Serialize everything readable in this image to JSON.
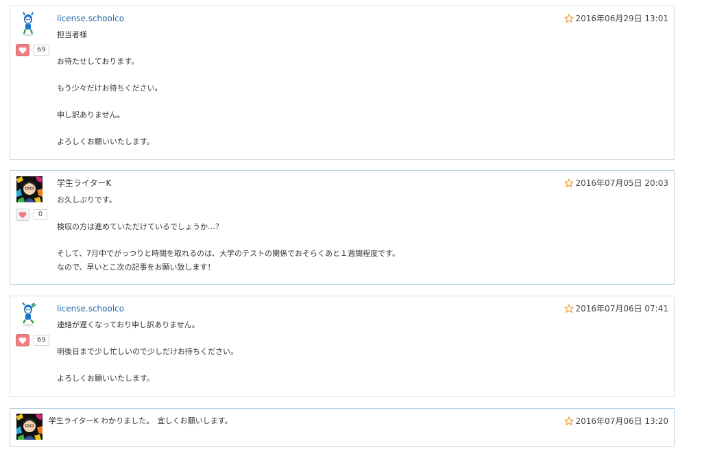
{
  "comments": [
    {
      "author": "license.schoolco",
      "date": "2016年06月29日 13:01",
      "likes": "69",
      "lines": [
        "担当者様",
        "",
        "お待たせしております。",
        "",
        "もう少々だけお待ちください。",
        "",
        "申し訳ありません。",
        "",
        "よろしくお願いいたします。"
      ]
    },
    {
      "author": "学生ライターK",
      "date": "2016年07月05日 20:03",
      "likes": "0",
      "lines": [
        "お久しぶりです。",
        "",
        "検収の方は進めていただけているでしょうか…？",
        "",
        "そして、7月中でがっつりと時間を取れるのは、大学のテストの関係でおそらくあと１週間程度です。",
        "なので、早いとこ次の記事をお願い致します！"
      ]
    },
    {
      "author": "license.schoolco",
      "date": "2016年07月06日 07:41",
      "likes": "69",
      "lines": [
        "連絡が遅くなっており申し訳ありません。",
        "",
        "明後日まで少し忙しいので少しだけお待ちください。",
        "",
        "よろしくお願いいたします。"
      ]
    },
    {
      "author": "学生ライターK",
      "text": "わかりました。　宜しくお願いします。",
      "date": "2016年07月06日 13:20"
    }
  ],
  "icons": {
    "star": "star-outline-icon",
    "heart": "heart-icon",
    "avatar_brand": "mascot-avatar-icon",
    "avatar_user": "user-photo-avatar-icon"
  },
  "colors": {
    "link": "#2a66a8",
    "heart_active": "#ee7d82",
    "star": "#f0a030",
    "border_blue": "#b7d3e6",
    "border_gray": "#dcdcdc"
  }
}
